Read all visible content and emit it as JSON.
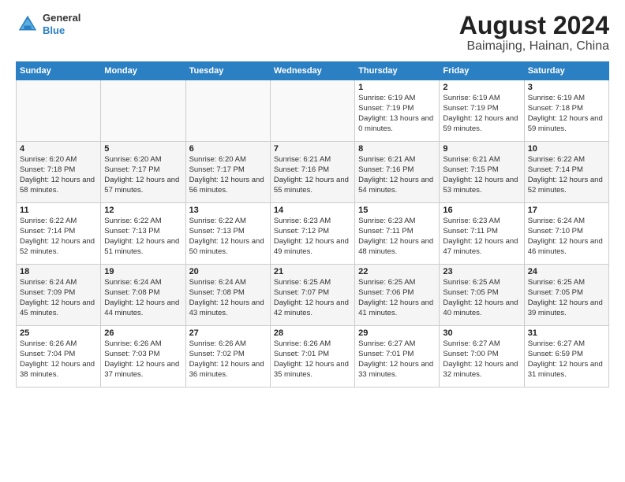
{
  "header": {
    "logo_line1": "General",
    "logo_line2": "Blue",
    "month_year": "August 2024",
    "location": "Baimajing, Hainan, China"
  },
  "days_of_week": [
    "Sunday",
    "Monday",
    "Tuesday",
    "Wednesday",
    "Thursday",
    "Friday",
    "Saturday"
  ],
  "weeks": [
    [
      {
        "day": "",
        "sunrise": "",
        "sunset": "",
        "daylight": "",
        "empty": true
      },
      {
        "day": "",
        "sunrise": "",
        "sunset": "",
        "daylight": "",
        "empty": true
      },
      {
        "day": "",
        "sunrise": "",
        "sunset": "",
        "daylight": "",
        "empty": true
      },
      {
        "day": "",
        "sunrise": "",
        "sunset": "",
        "daylight": "",
        "empty": true
      },
      {
        "day": "1",
        "sunrise": "Sunrise: 6:19 AM",
        "sunset": "Sunset: 7:19 PM",
        "daylight": "Daylight: 13 hours and 0 minutes."
      },
      {
        "day": "2",
        "sunrise": "Sunrise: 6:19 AM",
        "sunset": "Sunset: 7:19 PM",
        "daylight": "Daylight: 12 hours and 59 minutes."
      },
      {
        "day": "3",
        "sunrise": "Sunrise: 6:19 AM",
        "sunset": "Sunset: 7:18 PM",
        "daylight": "Daylight: 12 hours and 59 minutes."
      }
    ],
    [
      {
        "day": "4",
        "sunrise": "Sunrise: 6:20 AM",
        "sunset": "Sunset: 7:18 PM",
        "daylight": "Daylight: 12 hours and 58 minutes."
      },
      {
        "day": "5",
        "sunrise": "Sunrise: 6:20 AM",
        "sunset": "Sunset: 7:17 PM",
        "daylight": "Daylight: 12 hours and 57 minutes."
      },
      {
        "day": "6",
        "sunrise": "Sunrise: 6:20 AM",
        "sunset": "Sunset: 7:17 PM",
        "daylight": "Daylight: 12 hours and 56 minutes."
      },
      {
        "day": "7",
        "sunrise": "Sunrise: 6:21 AM",
        "sunset": "Sunset: 7:16 PM",
        "daylight": "Daylight: 12 hours and 55 minutes."
      },
      {
        "day": "8",
        "sunrise": "Sunrise: 6:21 AM",
        "sunset": "Sunset: 7:16 PM",
        "daylight": "Daylight: 12 hours and 54 minutes."
      },
      {
        "day": "9",
        "sunrise": "Sunrise: 6:21 AM",
        "sunset": "Sunset: 7:15 PM",
        "daylight": "Daylight: 12 hours and 53 minutes."
      },
      {
        "day": "10",
        "sunrise": "Sunrise: 6:22 AM",
        "sunset": "Sunset: 7:14 PM",
        "daylight": "Daylight: 12 hours and 52 minutes."
      }
    ],
    [
      {
        "day": "11",
        "sunrise": "Sunrise: 6:22 AM",
        "sunset": "Sunset: 7:14 PM",
        "daylight": "Daylight: 12 hours and 52 minutes."
      },
      {
        "day": "12",
        "sunrise": "Sunrise: 6:22 AM",
        "sunset": "Sunset: 7:13 PM",
        "daylight": "Daylight: 12 hours and 51 minutes."
      },
      {
        "day": "13",
        "sunrise": "Sunrise: 6:22 AM",
        "sunset": "Sunset: 7:13 PM",
        "daylight": "Daylight: 12 hours and 50 minutes."
      },
      {
        "day": "14",
        "sunrise": "Sunrise: 6:23 AM",
        "sunset": "Sunset: 7:12 PM",
        "daylight": "Daylight: 12 hours and 49 minutes."
      },
      {
        "day": "15",
        "sunrise": "Sunrise: 6:23 AM",
        "sunset": "Sunset: 7:11 PM",
        "daylight": "Daylight: 12 hours and 48 minutes."
      },
      {
        "day": "16",
        "sunrise": "Sunrise: 6:23 AM",
        "sunset": "Sunset: 7:11 PM",
        "daylight": "Daylight: 12 hours and 47 minutes."
      },
      {
        "day": "17",
        "sunrise": "Sunrise: 6:24 AM",
        "sunset": "Sunset: 7:10 PM",
        "daylight": "Daylight: 12 hours and 46 minutes."
      }
    ],
    [
      {
        "day": "18",
        "sunrise": "Sunrise: 6:24 AM",
        "sunset": "Sunset: 7:09 PM",
        "daylight": "Daylight: 12 hours and 45 minutes."
      },
      {
        "day": "19",
        "sunrise": "Sunrise: 6:24 AM",
        "sunset": "Sunset: 7:08 PM",
        "daylight": "Daylight: 12 hours and 44 minutes."
      },
      {
        "day": "20",
        "sunrise": "Sunrise: 6:24 AM",
        "sunset": "Sunset: 7:08 PM",
        "daylight": "Daylight: 12 hours and 43 minutes."
      },
      {
        "day": "21",
        "sunrise": "Sunrise: 6:25 AM",
        "sunset": "Sunset: 7:07 PM",
        "daylight": "Daylight: 12 hours and 42 minutes."
      },
      {
        "day": "22",
        "sunrise": "Sunrise: 6:25 AM",
        "sunset": "Sunset: 7:06 PM",
        "daylight": "Daylight: 12 hours and 41 minutes."
      },
      {
        "day": "23",
        "sunrise": "Sunrise: 6:25 AM",
        "sunset": "Sunset: 7:05 PM",
        "daylight": "Daylight: 12 hours and 40 minutes."
      },
      {
        "day": "24",
        "sunrise": "Sunrise: 6:25 AM",
        "sunset": "Sunset: 7:05 PM",
        "daylight": "Daylight: 12 hours and 39 minutes."
      }
    ],
    [
      {
        "day": "25",
        "sunrise": "Sunrise: 6:26 AM",
        "sunset": "Sunset: 7:04 PM",
        "daylight": "Daylight: 12 hours and 38 minutes."
      },
      {
        "day": "26",
        "sunrise": "Sunrise: 6:26 AM",
        "sunset": "Sunset: 7:03 PM",
        "daylight": "Daylight: 12 hours and 37 minutes."
      },
      {
        "day": "27",
        "sunrise": "Sunrise: 6:26 AM",
        "sunset": "Sunset: 7:02 PM",
        "daylight": "Daylight: 12 hours and 36 minutes."
      },
      {
        "day": "28",
        "sunrise": "Sunrise: 6:26 AM",
        "sunset": "Sunset: 7:01 PM",
        "daylight": "Daylight: 12 hours and 35 minutes."
      },
      {
        "day": "29",
        "sunrise": "Sunrise: 6:27 AM",
        "sunset": "Sunset: 7:01 PM",
        "daylight": "Daylight: 12 hours and 33 minutes."
      },
      {
        "day": "30",
        "sunrise": "Sunrise: 6:27 AM",
        "sunset": "Sunset: 7:00 PM",
        "daylight": "Daylight: 12 hours and 32 minutes."
      },
      {
        "day": "31",
        "sunrise": "Sunrise: 6:27 AM",
        "sunset": "Sunset: 6:59 PM",
        "daylight": "Daylight: 12 hours and 31 minutes."
      }
    ]
  ]
}
